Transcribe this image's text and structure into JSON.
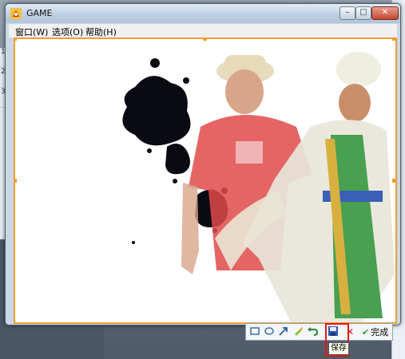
{
  "window": {
    "title": "GAME",
    "minimize_glyph": "–",
    "maximize_glyph": "□",
    "close_glyph": "✕"
  },
  "menu": {
    "items": [
      "窗口(W)",
      "选项(O)",
      "帮助(H)"
    ]
  },
  "toolbar": {
    "icons": [
      "rectangle-icon",
      "ellipse-icon",
      "arrow-icon",
      "brush-icon",
      "undo-icon",
      "save-icon",
      "cancel-icon"
    ],
    "done_label": "完成"
  },
  "tooltip": {
    "text": "保存"
  },
  "background": {
    "list_text": [
      "1",
      "2",
      "3"
    ]
  },
  "colors": {
    "selection_border": "#f0a030",
    "highlight_red": "#e01818",
    "done_green": "#2a9a2a"
  }
}
